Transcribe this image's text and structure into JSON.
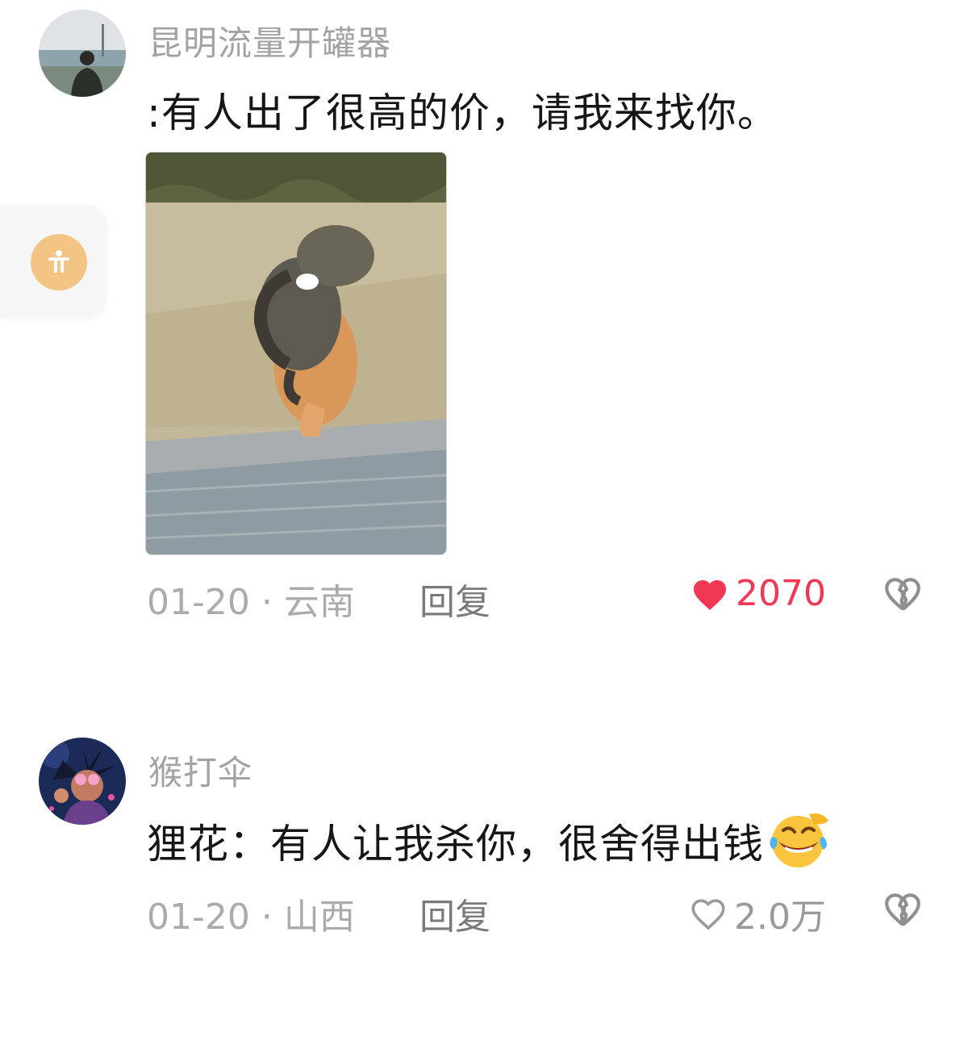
{
  "comments": [
    {
      "username": "昆明流量开罐器",
      "text": ":有人出了很高的价，请我来找你。",
      "has_image": true,
      "date": "01-20",
      "location": "云南",
      "reply_label": "回复",
      "likes": "2070",
      "liked": true
    },
    {
      "username": "猴打伞",
      "text": "狸花：有人让我杀你，很舍得出钱",
      "emoji": "face-with-tears-of-joy",
      "date": "01-20",
      "location": "山西",
      "reply_label": "回复",
      "likes": "2.0万",
      "liked": false
    }
  ],
  "separator": "·",
  "colors": {
    "liked": "#f03855",
    "muted": "#ababab",
    "accessibility_button": "#f3c584"
  },
  "icons": [
    "heart-filled-icon",
    "heart-outline-icon",
    "broken-heart-icon",
    "accessibility-icon"
  ]
}
